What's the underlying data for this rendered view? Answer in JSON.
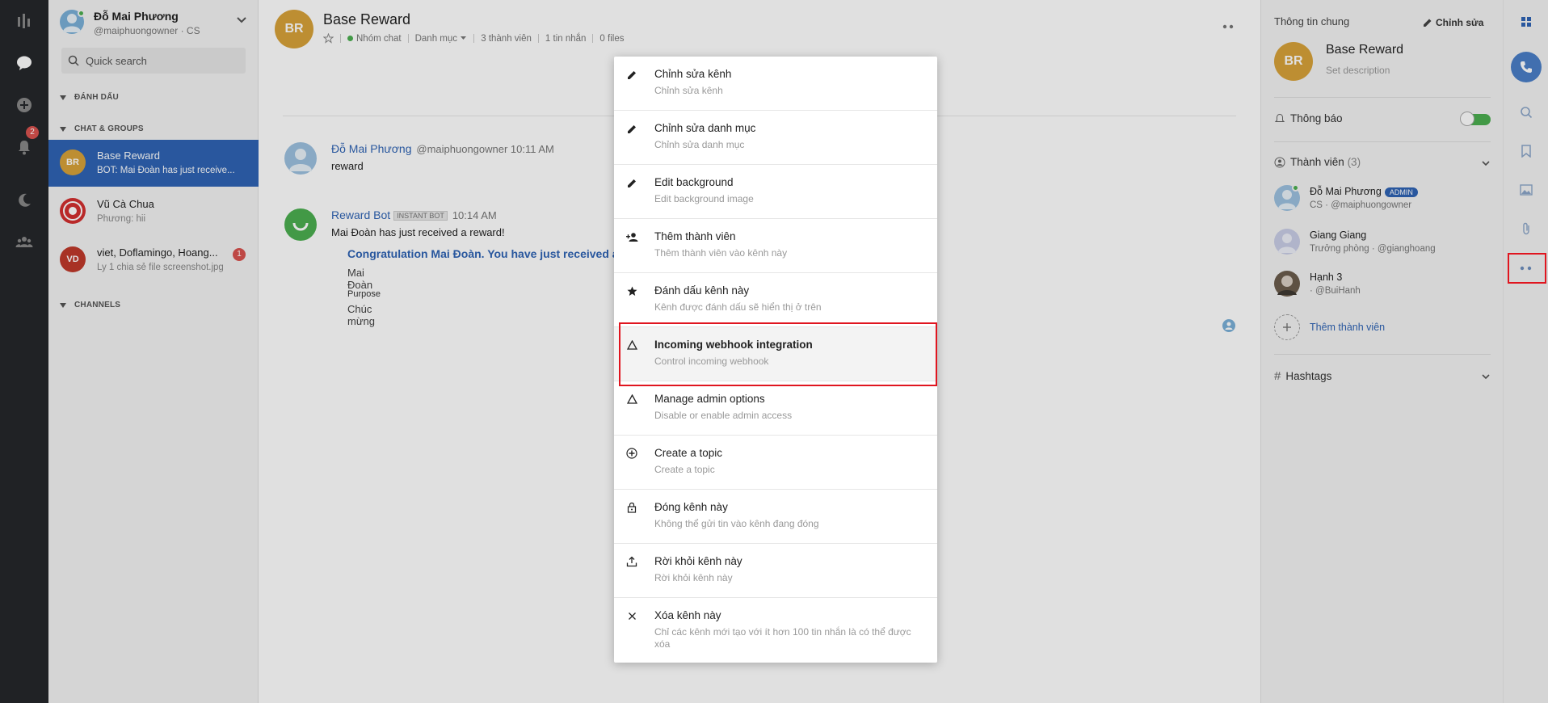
{
  "user": {
    "name": "Đỗ Mai Phương",
    "handle": "@maiphuongowner · CS"
  },
  "search": {
    "placeholder": "Quick search"
  },
  "rail": {
    "notif_count": "2"
  },
  "sections": {
    "bookmarks": "ĐÁNH DẤU",
    "chats": "CHAT & GROUPS",
    "channels": "CHANNELS"
  },
  "conversations": [
    {
      "initials": "BR",
      "title": "Base Reward",
      "snippet": "BOT: Mai Đoàn has just receive...",
      "color": "#d8a23a"
    },
    {
      "initials": "",
      "title": "Vũ Cà Chua",
      "snippet": "Phương: hii",
      "color": "#d32f2f"
    },
    {
      "initials": "VD",
      "title": "viet, Doflamingo, Hoang...",
      "snippet": "Ly 1 chia sẻ file screenshot.jpg",
      "color": "#c0392b",
      "badge": "1"
    }
  ],
  "chat": {
    "initials": "BR",
    "title": "Base Reward",
    "meta": {
      "type": "Nhóm chat",
      "category": "Danh mục",
      "members": "3 thành viên",
      "messages": "1 tin nhắn",
      "files": "0 files"
    },
    "messages": [
      {
        "user": "Đỗ Mai Phương",
        "meta": "@maiphuongowner  10:11 AM",
        "text": "reward"
      },
      {
        "user": "Reward Bot",
        "badge": "INSTANT BOT",
        "meta": "10:14 AM",
        "text": "Mai Đoàn has just received a reward!",
        "attachment": {
          "title": "Congratulation Mai Đoàn. You have just received a",
          "name": "Mai Đoàn",
          "label": "Purpose",
          "value": "Chúc mừng"
        }
      }
    ]
  },
  "menu": {
    "items": [
      {
        "icon": "pencil-icon",
        "label": "Chỉnh sửa kênh",
        "desc": "Chỉnh sửa kênh"
      },
      {
        "icon": "pencil-icon",
        "label": "Chỉnh sửa danh mục",
        "desc": "Chỉnh sửa danh mục"
      },
      {
        "icon": "pencil-icon",
        "label": "Edit background",
        "desc": "Edit background image"
      },
      {
        "icon": "add-person-icon",
        "label": "Thêm thành viên",
        "desc": "Thêm thành viên vào kênh này"
      },
      {
        "icon": "star-icon",
        "label": "Đánh dấu kênh này",
        "desc": "Kênh được đánh dấu sẽ hiển thị ở trên"
      },
      {
        "icon": "triangle-icon",
        "label": "Incoming webhook integration",
        "desc": "Control incoming webhook",
        "highlight": true
      },
      {
        "icon": "triangle-icon",
        "label": "Manage admin options",
        "desc": "Disable or enable admin access"
      },
      {
        "icon": "plus-circle-icon",
        "label": "Create a topic",
        "desc": "Create a topic"
      },
      {
        "icon": "lock-icon",
        "label": "Đóng kênh này",
        "desc": "Không thể gửi tin vào kênh đang đóng"
      },
      {
        "icon": "upload-icon",
        "label": "Rời khỏi kênh này",
        "desc": "Rời khỏi kênh này"
      },
      {
        "icon": "close-icon",
        "label": "Xóa kênh này",
        "desc": "Chỉ các kênh mới tạo với ít hơn 100 tin nhắn là có thể được xóa"
      }
    ]
  },
  "panel": {
    "heading": "Thông tin chung",
    "edit": "Chỉnh sửa",
    "initials": "BR",
    "title": "Base Reward",
    "description": "Set description",
    "notify": "Thông báo",
    "members_label": "Thành viên",
    "members_count": "(3)",
    "members": [
      {
        "name": "Đỗ Mai Phương",
        "badge": "ADMIN",
        "sub": "CS · @maiphuongowner"
      },
      {
        "name": "Giang Giang",
        "sub": "Trưởng phòng · @gianghoang"
      },
      {
        "name": "Hạnh 3",
        "sub": "· @BuiHanh"
      }
    ],
    "add_member": "Thêm thành viên",
    "hashtags": "Hashtags"
  },
  "colors": {
    "accent": "#2f64b4",
    "rail": "#25272b",
    "reward_avatar": "#d8a23a",
    "highlight_box": "#e0151f"
  }
}
